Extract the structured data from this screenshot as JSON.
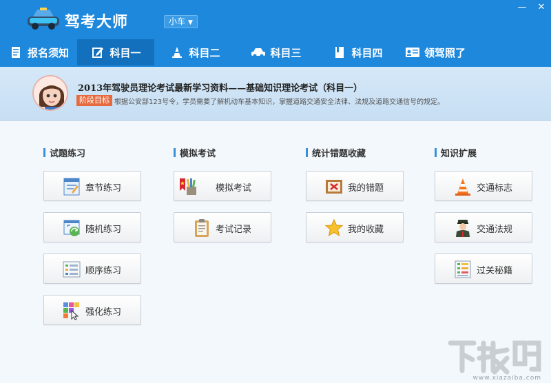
{
  "app": {
    "title": "驾考大师",
    "vehicle_select": "小车"
  },
  "window": {
    "minimize": "—",
    "close": "✕"
  },
  "nav": {
    "tabs": [
      {
        "label": "报名须知",
        "icon": "doc-icon",
        "active": false
      },
      {
        "label": "科目一",
        "icon": "edit-icon",
        "active": true
      },
      {
        "label": "科目二",
        "icon": "cone-icon",
        "active": false
      },
      {
        "label": "科目三",
        "icon": "car-icon",
        "active": false
      },
      {
        "label": "科目四",
        "icon": "book-icon",
        "active": false
      },
      {
        "label": "领驾照了",
        "icon": "license-icon",
        "active": false
      }
    ]
  },
  "banner": {
    "title": "2013年驾驶员理论考试最新学习资料——基础知识理论考试（科目一）",
    "badge": "阶段目标",
    "description": "根据公安部123号令，学员需要了解机动车基本知识，掌握道路交通安全法律、法规及道路交通信号的规定。"
  },
  "sections": [
    {
      "title": "试题练习",
      "buttons": [
        "章节练习",
        "随机练习",
        "顺序练习",
        "强化练习"
      ]
    },
    {
      "title": "模拟考试",
      "buttons": [
        "模拟考试",
        "考试记录"
      ]
    },
    {
      "title": "统计错题收藏",
      "buttons": [
        "我的错题",
        "我的收藏"
      ]
    },
    {
      "title": "知识扩展",
      "buttons": [
        "交通标志",
        "交通法规",
        "过关秘籍"
      ]
    }
  ],
  "watermark": {
    "text": "下载吧",
    "url": "www.xiazaiba.com"
  },
  "colors": {
    "title_bar": "#1e88dc",
    "active_tab": "#1370bd",
    "badge": "#e66a3d",
    "section_bar": "#3a8fd6"
  }
}
